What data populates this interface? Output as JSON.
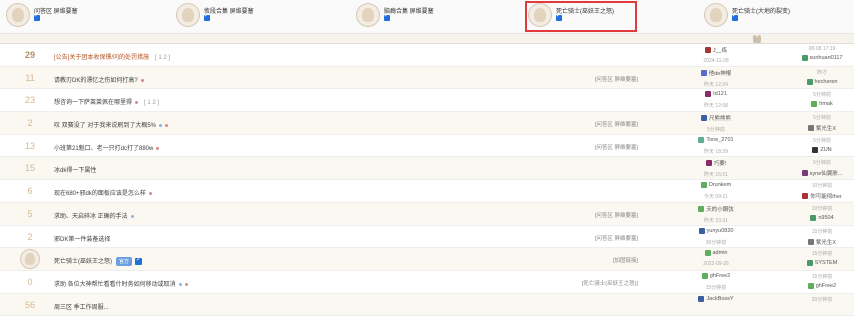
{
  "tabs": [
    {
      "name": "问答区 屏维要塞",
      "active": false
    },
    {
      "name": "攸段合集 屏维要塞",
      "active": false
    },
    {
      "name": "脑瘾合集 屏维要塞",
      "active": false
    },
    {
      "name": "死亡骑士(巫妖王之怒)",
      "active": true
    },
    {
      "name": "死亡骑士(大地的裂变)",
      "active": false
    }
  ],
  "threads": [
    {
      "count": "29",
      "title": "[公告]关于团本收保镖/问的处罚措施",
      "pages": "[ 1 2 ]",
      "tag": "",
      "author": "J__练",
      "author_time": "2024-11-28",
      "last_time": "08-08 17:19",
      "last_user": "sunhuan0117",
      "author_color": "#a33",
      "last_color": "#4a9a6a",
      "strong": true
    },
    {
      "count": "11",
      "title": "请教刃DK的漂忆之伤如何打高?",
      "pages": "",
      "tag": "[问答区 屏维要塞]",
      "author": "他de神棍",
      "author_time": "昨天 12:24",
      "last_time": "昨才",
      "last_user": "hecheren",
      "author_color": "#5a6cc8",
      "last_color": "#4a9a6a",
      "strong": false
    },
    {
      "count": "23",
      "title": "想咨询一下萨莱莱佩在哪里得",
      "pages": "[ 1 2 ]",
      "tag": "",
      "author": "Id121",
      "author_time": "昨天 12:08",
      "last_time": "5分钟前",
      "last_user": "hmak",
      "author_color": "#8a2a6a",
      "last_color": "#5fae5f",
      "strong": false
    },
    {
      "count": "2",
      "title": "叹 双赛没了 对于我来说刷到了大概5%",
      "pages": "",
      "tag": "[问答区 屏维要塞]",
      "author": "尺熊熊熊",
      "author_time": "5分钟前",
      "last_time": "5分钟前",
      "last_user": "紫光生X",
      "author_color": "#3c5fa0",
      "last_color": "#777",
      "strong": false
    },
    {
      "count": "13",
      "title": "小班第21魁口、老一只打dc打了880w",
      "pages": "",
      "tag": "[问答区 屏维要塞]",
      "author": "Tone_2701",
      "author_time": "昨天 18:39",
      "last_time": "5分钟前",
      "last_user": "ZUN",
      "author_color": "#5fae8f",
      "last_color": "#333",
      "strong": false
    },
    {
      "count": "15",
      "title": "冰dk得一下属性",
      "pages": "",
      "tag": "",
      "author": "巧要!",
      "author_time": "昨天 15:51",
      "last_time": "5分钟前",
      "last_user": "syne仙翼肤...",
      "author_color": "#8a2a6a",
      "last_color": "#7a3a7a",
      "strong": false
    },
    {
      "count": "6",
      "title": "现在680+邪dk的面板应该是怎么样",
      "pages": "",
      "tag": "",
      "author": "Drunkem",
      "author_time": "今天 09:21",
      "last_time": "10分钟前",
      "last_user": "你可能彻ther",
      "author_color": "#5fae5f",
      "last_color": "#a33",
      "strong": false
    },
    {
      "count": "5",
      "title": "求助、天启碎冰 正确的手法",
      "pages": "",
      "tag": "[问答区 屏维要塞]",
      "author": "天的小鋼弦",
      "author_time": "昨天 23:31",
      "last_time": "10分钟前",
      "last_user": "n9504",
      "author_color": "#5fae5f",
      "last_color": "#4a9a6a",
      "strong": false
    },
    {
      "count": "2",
      "title": "邪DK第一件装备选择",
      "pages": "",
      "tag": "[问答区 屏维要塞]",
      "author": "yunyu0820",
      "author_time": "30分钟前",
      "last_time": "15分钟前",
      "last_user": "紫光生X",
      "author_color": "#3c5fa0",
      "last_color": "#777",
      "strong": false
    }
  ],
  "forum_row": {
    "name": "死亡骑士(巫妖王之怒)",
    "badge": "官方",
    "tag": "[加固链接]",
    "author": "admin",
    "author_time": "2022-09-26",
    "last_time": "15分钟前",
    "last_user": "SYSTEM",
    "author_color": "#5fae5f",
    "last_color": "#4a9a6a"
  },
  "extra_threads": [
    {
      "count": "0",
      "title": "求助 各位大神帮忙看看什时务如何移动或取消",
      "tag": "[死亡骑士(巫妖王之怒)]",
      "author": "ghFree2",
      "author_time": "15分钟前",
      "last_time": "15分钟前",
      "last_user": "ghFree2",
      "author_color": "#5fae5f",
      "last_color": "#5fae5f"
    },
    {
      "count": "56",
      "title": "周三区 季工作周服...",
      "tag": "",
      "author": "JackBossY",
      "author_time": "",
      "last_time": "20分钟前",
      "last_user": "",
      "author_color": "#3c5fa0",
      "last_color": "#777"
    }
  ]
}
